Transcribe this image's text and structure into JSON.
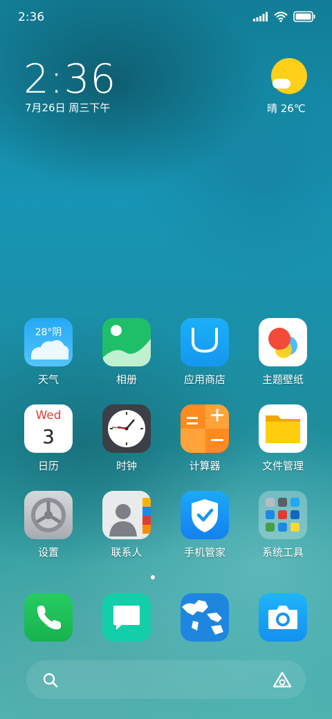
{
  "status_bar": {
    "time": "2:36",
    "icons": [
      "signal-icon",
      "wifi-icon",
      "battery-icon"
    ]
  },
  "widget": {
    "clock": "2:36",
    "date": "7月26日 周三下午",
    "weather": "晴 26℃"
  },
  "apps": [
    {
      "name": "天气",
      "icon": "weather-app-icon",
      "badge_text": "28°阴"
    },
    {
      "name": "相册",
      "icon": "gallery-app-icon"
    },
    {
      "name": "应用商店",
      "icon": "app-store-icon"
    },
    {
      "name": "主题壁纸",
      "icon": "themes-app-icon"
    },
    {
      "name": "日历",
      "icon": "calendar-app-icon",
      "weekday": "Wed",
      "day": "3"
    },
    {
      "name": "时钟",
      "icon": "clock-app-icon"
    },
    {
      "name": "计算器",
      "icon": "calculator-app-icon"
    },
    {
      "name": "文件管理",
      "icon": "file-manager-icon"
    },
    {
      "name": "设置",
      "icon": "settings-app-icon"
    },
    {
      "name": "联系人",
      "icon": "contacts-app-icon"
    },
    {
      "name": "手机管家",
      "icon": "security-app-icon"
    },
    {
      "name": "系统工具",
      "icon": "system-tools-folder-icon"
    }
  ],
  "page_indicator": {
    "current": 1,
    "total": 1
  },
  "dock": [
    {
      "icon": "phone-app-icon"
    },
    {
      "icon": "messages-app-icon"
    },
    {
      "icon": "browser-app-icon"
    },
    {
      "icon": "camera-app-icon"
    }
  ],
  "search_bar": {
    "left_icon": "search-icon",
    "right_icon": "assistant-icon"
  },
  "colors": {
    "sun": "#ffcf1a",
    "weather_app": "#2aa6f0",
    "gallery_app": "#1fbf6a",
    "app_store": "#19a9f5",
    "calculator": "#ff8a1f",
    "file_manager": "#f7c100",
    "security_app": "#1596f7",
    "phone": "#1fc25a",
    "messages": "#12cfaa",
    "camera": "#17a7f5"
  }
}
